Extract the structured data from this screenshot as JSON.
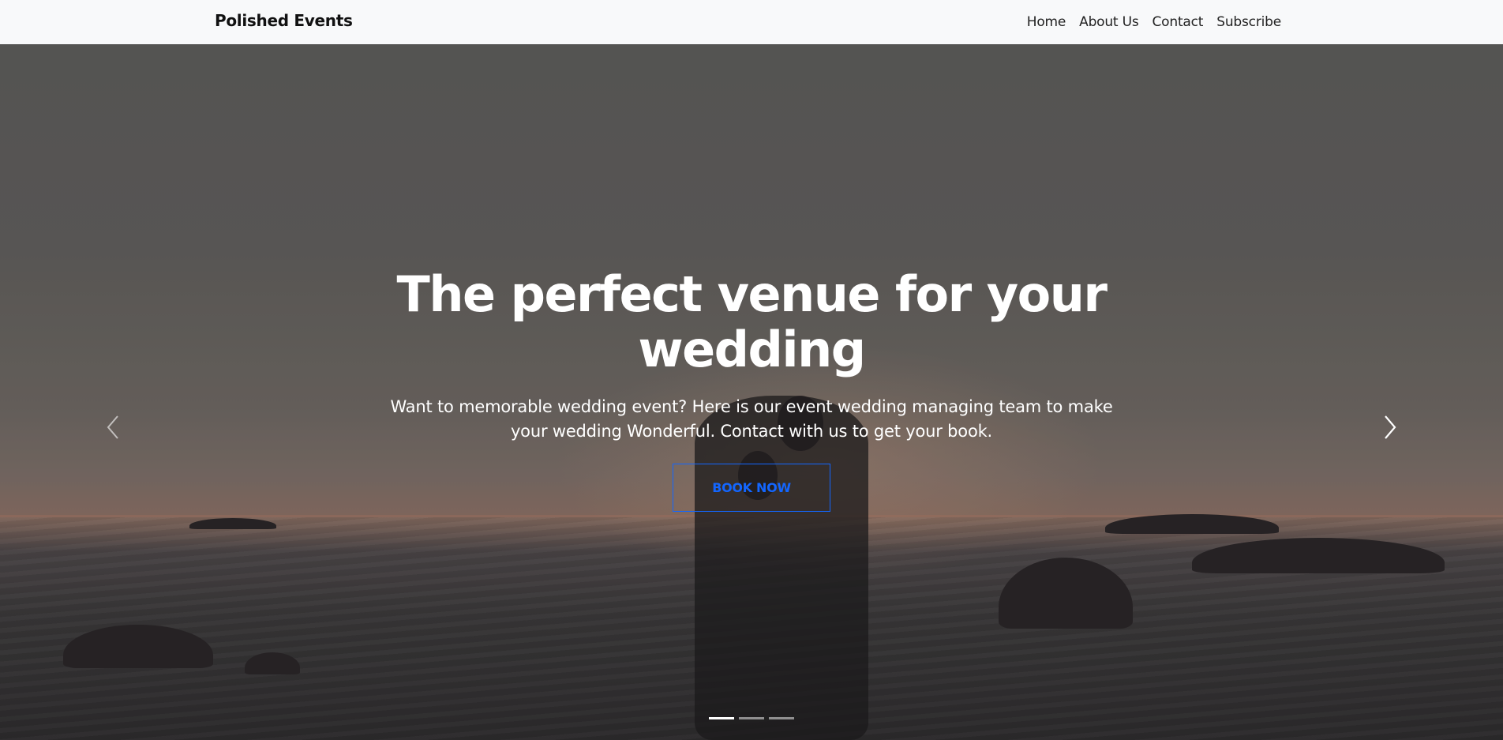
{
  "navbar": {
    "brand": "Polished Events",
    "links": [
      "Home",
      "About Us",
      "Contact",
      "Subscribe"
    ]
  },
  "hero": {
    "title": "The perfect venue for your wedding",
    "description": "Want to memorable wedding event? Here is our event wedding managing team to make your wedding Wonderful. Contact with us to get your book.",
    "button_label": "BOOK NOW",
    "active_slide": 1,
    "slide_count": 3
  },
  "icons": {
    "prev": "chevron-left-icon",
    "next": "chevron-right-icon"
  },
  "colors": {
    "navbar_bg": "#f8f9fa",
    "accent": "#1366ff",
    "text_light": "#ffffff"
  }
}
